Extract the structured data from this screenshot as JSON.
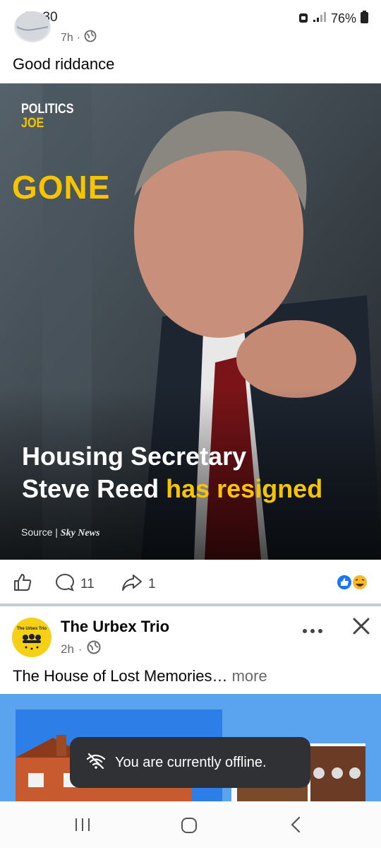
{
  "status_bar": {
    "time": "00:30",
    "battery": "76%"
  },
  "post1": {
    "time": "7h",
    "caption": "Good riddance",
    "image": {
      "brand_line1": "POLITICS",
      "brand_line2": "JOE",
      "stamp": "GONE",
      "headline_line1": "Housing Secretary",
      "headline_line2_white": "Steve Reed ",
      "headline_line2_yellow": "has resigned",
      "source_label": "Source | ",
      "source_name": "Sky News"
    },
    "comment_count": "11",
    "share_count": "1"
  },
  "post2": {
    "page_name": "The Urbex Trio",
    "avatar_text": "The Urbex Trio",
    "time": "2h",
    "caption": "The House of Lost Memories…",
    "more_label": " more"
  },
  "toast": {
    "message": "You are currently offline."
  },
  "colors": {
    "brand_yellow": "#f6c400",
    "like_blue": "#1877f2",
    "haha_yellow": "#f7b928"
  }
}
